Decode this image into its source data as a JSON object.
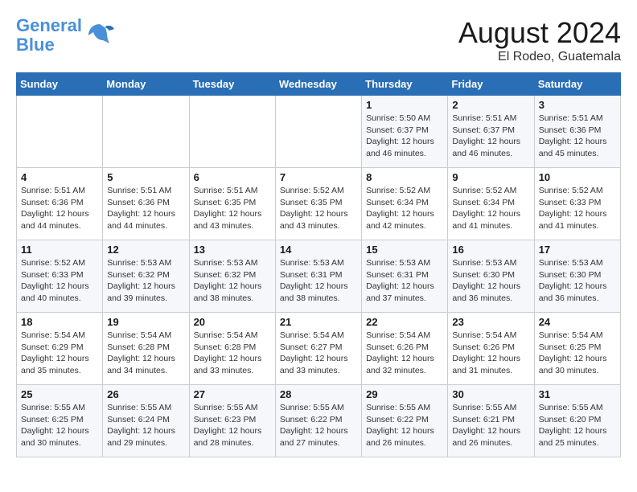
{
  "header": {
    "logo_line1": "General",
    "logo_line2": "Blue",
    "month_title": "August 2024",
    "location": "El Rodeo, Guatemala"
  },
  "weekdays": [
    "Sunday",
    "Monday",
    "Tuesday",
    "Wednesday",
    "Thursday",
    "Friday",
    "Saturday"
  ],
  "weeks": [
    [
      {
        "day": "",
        "info": ""
      },
      {
        "day": "",
        "info": ""
      },
      {
        "day": "",
        "info": ""
      },
      {
        "day": "",
        "info": ""
      },
      {
        "day": "1",
        "info": "Sunrise: 5:50 AM\nSunset: 6:37 PM\nDaylight: 12 hours\nand 46 minutes."
      },
      {
        "day": "2",
        "info": "Sunrise: 5:51 AM\nSunset: 6:37 PM\nDaylight: 12 hours\nand 46 minutes."
      },
      {
        "day": "3",
        "info": "Sunrise: 5:51 AM\nSunset: 6:36 PM\nDaylight: 12 hours\nand 45 minutes."
      }
    ],
    [
      {
        "day": "4",
        "info": "Sunrise: 5:51 AM\nSunset: 6:36 PM\nDaylight: 12 hours\nand 44 minutes."
      },
      {
        "day": "5",
        "info": "Sunrise: 5:51 AM\nSunset: 6:36 PM\nDaylight: 12 hours\nand 44 minutes."
      },
      {
        "day": "6",
        "info": "Sunrise: 5:51 AM\nSunset: 6:35 PM\nDaylight: 12 hours\nand 43 minutes."
      },
      {
        "day": "7",
        "info": "Sunrise: 5:52 AM\nSunset: 6:35 PM\nDaylight: 12 hours\nand 43 minutes."
      },
      {
        "day": "8",
        "info": "Sunrise: 5:52 AM\nSunset: 6:34 PM\nDaylight: 12 hours\nand 42 minutes."
      },
      {
        "day": "9",
        "info": "Sunrise: 5:52 AM\nSunset: 6:34 PM\nDaylight: 12 hours\nand 41 minutes."
      },
      {
        "day": "10",
        "info": "Sunrise: 5:52 AM\nSunset: 6:33 PM\nDaylight: 12 hours\nand 41 minutes."
      }
    ],
    [
      {
        "day": "11",
        "info": "Sunrise: 5:52 AM\nSunset: 6:33 PM\nDaylight: 12 hours\nand 40 minutes."
      },
      {
        "day": "12",
        "info": "Sunrise: 5:53 AM\nSunset: 6:32 PM\nDaylight: 12 hours\nand 39 minutes."
      },
      {
        "day": "13",
        "info": "Sunrise: 5:53 AM\nSunset: 6:32 PM\nDaylight: 12 hours\nand 38 minutes."
      },
      {
        "day": "14",
        "info": "Sunrise: 5:53 AM\nSunset: 6:31 PM\nDaylight: 12 hours\nand 38 minutes."
      },
      {
        "day": "15",
        "info": "Sunrise: 5:53 AM\nSunset: 6:31 PM\nDaylight: 12 hours\nand 37 minutes."
      },
      {
        "day": "16",
        "info": "Sunrise: 5:53 AM\nSunset: 6:30 PM\nDaylight: 12 hours\nand 36 minutes."
      },
      {
        "day": "17",
        "info": "Sunrise: 5:53 AM\nSunset: 6:30 PM\nDaylight: 12 hours\nand 36 minutes."
      }
    ],
    [
      {
        "day": "18",
        "info": "Sunrise: 5:54 AM\nSunset: 6:29 PM\nDaylight: 12 hours\nand 35 minutes."
      },
      {
        "day": "19",
        "info": "Sunrise: 5:54 AM\nSunset: 6:28 PM\nDaylight: 12 hours\nand 34 minutes."
      },
      {
        "day": "20",
        "info": "Sunrise: 5:54 AM\nSunset: 6:28 PM\nDaylight: 12 hours\nand 33 minutes."
      },
      {
        "day": "21",
        "info": "Sunrise: 5:54 AM\nSunset: 6:27 PM\nDaylight: 12 hours\nand 33 minutes."
      },
      {
        "day": "22",
        "info": "Sunrise: 5:54 AM\nSunset: 6:26 PM\nDaylight: 12 hours\nand 32 minutes."
      },
      {
        "day": "23",
        "info": "Sunrise: 5:54 AM\nSunset: 6:26 PM\nDaylight: 12 hours\nand 31 minutes."
      },
      {
        "day": "24",
        "info": "Sunrise: 5:54 AM\nSunset: 6:25 PM\nDaylight: 12 hours\nand 30 minutes."
      }
    ],
    [
      {
        "day": "25",
        "info": "Sunrise: 5:55 AM\nSunset: 6:25 PM\nDaylight: 12 hours\nand 30 minutes."
      },
      {
        "day": "26",
        "info": "Sunrise: 5:55 AM\nSunset: 6:24 PM\nDaylight: 12 hours\nand 29 minutes."
      },
      {
        "day": "27",
        "info": "Sunrise: 5:55 AM\nSunset: 6:23 PM\nDaylight: 12 hours\nand 28 minutes."
      },
      {
        "day": "28",
        "info": "Sunrise: 5:55 AM\nSunset: 6:22 PM\nDaylight: 12 hours\nand 27 minutes."
      },
      {
        "day": "29",
        "info": "Sunrise: 5:55 AM\nSunset: 6:22 PM\nDaylight: 12 hours\nand 26 minutes."
      },
      {
        "day": "30",
        "info": "Sunrise: 5:55 AM\nSunset: 6:21 PM\nDaylight: 12 hours\nand 26 minutes."
      },
      {
        "day": "31",
        "info": "Sunrise: 5:55 AM\nSunset: 6:20 PM\nDaylight: 12 hours\nand 25 minutes."
      }
    ]
  ]
}
